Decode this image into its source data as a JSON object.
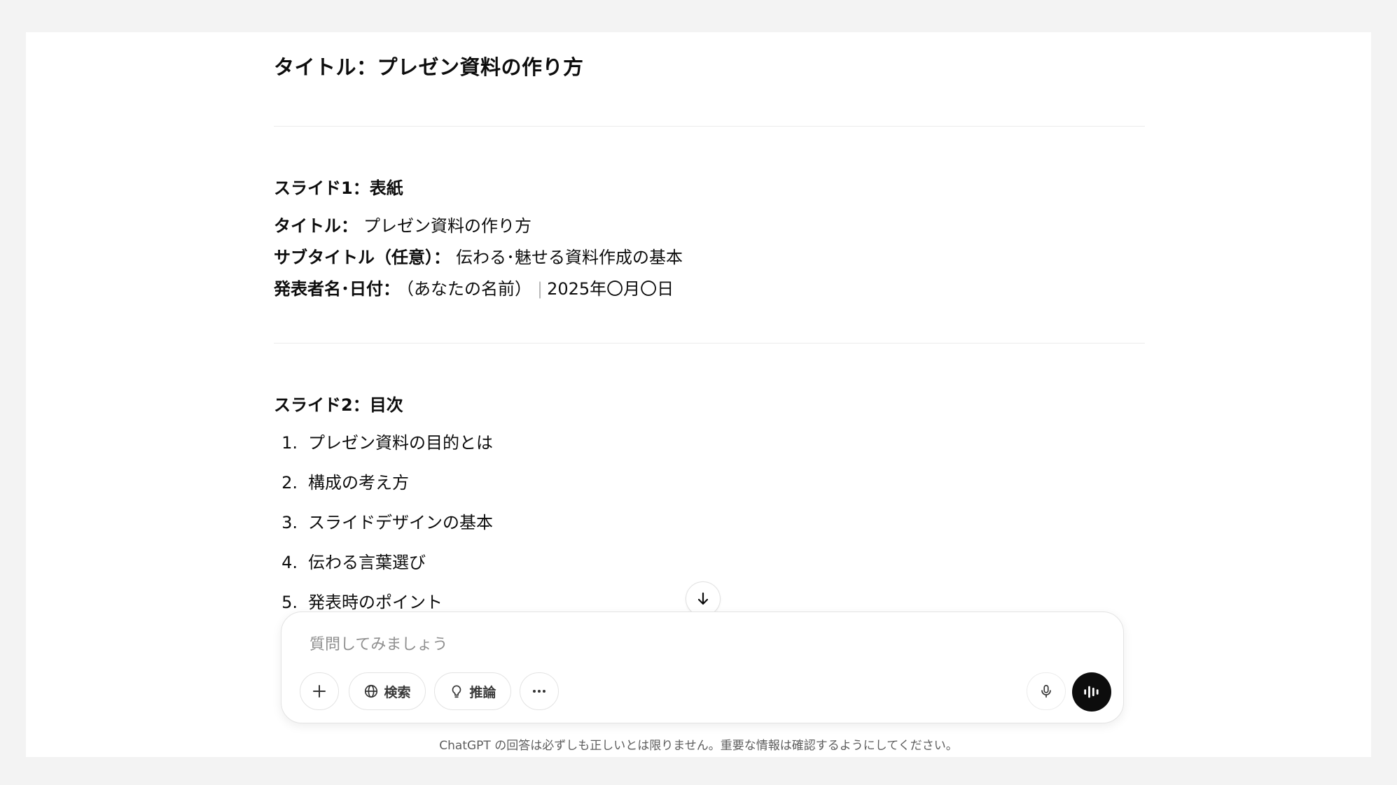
{
  "document": {
    "title": "タイトル：プレゼン資料の作り方",
    "slides": [
      {
        "heading": "スライド1：表紙",
        "fields": [
          {
            "label": "タイトル：",
            "value": "プレゼン資料の作り方"
          },
          {
            "label": "サブタイトル（任意）：",
            "value": "伝わる･魅せる資料作成の基本"
          },
          {
            "label": "発表者名･日付：",
            "value": "（あなたの名前）",
            "separator": "|",
            "value2": "2025年〇月〇日"
          }
        ]
      },
      {
        "heading": "スライド2：目次",
        "items": [
          {
            "num": "1.",
            "text": "プレゼン資料の目的とは"
          },
          {
            "num": "2.",
            "text": "構成の考え方"
          },
          {
            "num": "3.",
            "text": "スライドデザインの基本"
          },
          {
            "num": "4.",
            "text": "伝わる言葉選び"
          },
          {
            "num": "5.",
            "text": "発表時のポイント"
          }
        ]
      }
    ]
  },
  "composer": {
    "placeholder": "質問してみましょう",
    "tools": [
      {
        "icon": "plus-icon"
      },
      {
        "icon": "globe-icon",
        "label": "検索"
      },
      {
        "icon": "lightbulb-icon",
        "label": "推論"
      },
      {
        "icon": "more-icon"
      }
    ],
    "mic_icon": "microphone-icon",
    "voice_icon": "voice-mode-icon"
  },
  "scroll_icon": "arrow-down-icon",
  "disclaimer": "ChatGPT の回答は必ずしも正しいとは限りません。重要な情報は確認するようにしてください。",
  "colors": {
    "background": "#f3f3f3",
    "surface": "#ffffff",
    "text": "#0d0d0d",
    "muted": "#8f8f8f",
    "voice_button": "#0d0d0d"
  }
}
